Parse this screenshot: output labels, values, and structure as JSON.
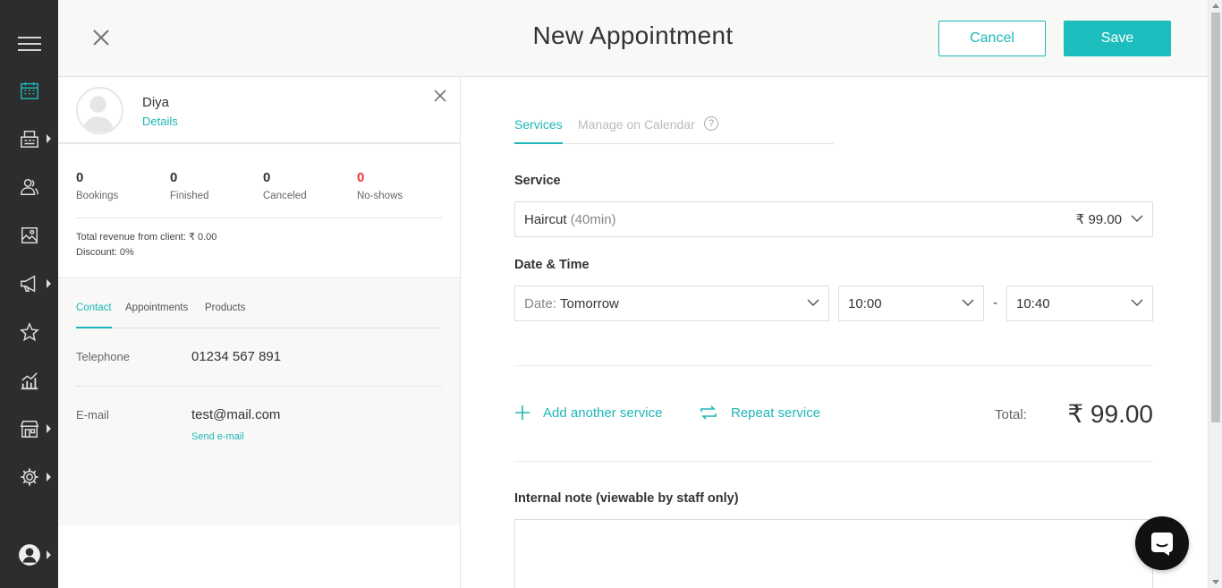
{
  "header": {
    "title": "New Appointment",
    "cancel_label": "Cancel",
    "save_label": "Save"
  },
  "sidebar": {
    "items": [
      {
        "name": "menu",
        "icon": "hamburger-icon"
      },
      {
        "name": "calendar",
        "icon": "calendar-icon",
        "active": true
      },
      {
        "name": "sales",
        "icon": "register-icon",
        "has_submenu": true
      },
      {
        "name": "clients",
        "icon": "clients-icon"
      },
      {
        "name": "gallery",
        "icon": "gallery-icon"
      },
      {
        "name": "marketing",
        "icon": "megaphone-icon",
        "has_submenu": true
      },
      {
        "name": "reviews",
        "icon": "star-icon"
      },
      {
        "name": "reports",
        "icon": "chart-icon"
      },
      {
        "name": "store",
        "icon": "store-icon",
        "has_submenu": true
      },
      {
        "name": "settings",
        "icon": "gear-icon",
        "has_submenu": true
      },
      {
        "name": "account",
        "icon": "user-icon",
        "has_submenu": true
      }
    ]
  },
  "client": {
    "name": "Diya",
    "details_link": "Details",
    "stats": [
      {
        "value": "0",
        "label": "Bookings"
      },
      {
        "value": "0",
        "label": "Finished"
      },
      {
        "value": "0",
        "label": "Canceled"
      },
      {
        "value": "0",
        "label": "No-shows",
        "highlight": "#e53935"
      }
    ],
    "revenue": "Total revenue from client: ₹ 0.00",
    "discount": "Discount: 0%",
    "tabs": [
      "Contact",
      "Appointments",
      "Products"
    ],
    "active_tab": "Contact",
    "telephone_label": "Telephone",
    "telephone_value": "01234 567 891",
    "email_label": "E-mail",
    "email_value": "test@mail.com",
    "send_email": "Send e-mail"
  },
  "form": {
    "tabs": {
      "services": "Services",
      "manage": "Manage on Calendar",
      "help": "?"
    },
    "service_label": "Service",
    "service_name": "Haircut",
    "service_duration": "(40min)",
    "service_price": "₹ 99.00",
    "datetime_label": "Date & Time",
    "date_prefix": "Date:",
    "date_value": "Tomorrow",
    "start_time": "10:00",
    "separator": "-",
    "end_time": "10:40",
    "add_service": "Add another service",
    "repeat_service": "Repeat service",
    "total_label": "Total:",
    "total_value": "₹ 99.00",
    "note_label": "Internal note (viewable by staff only)",
    "note_value": ""
  },
  "colors": {
    "accent": "#1eb6b6",
    "sidebar_bg": "#2d2d2d",
    "alert": "#e53935"
  }
}
